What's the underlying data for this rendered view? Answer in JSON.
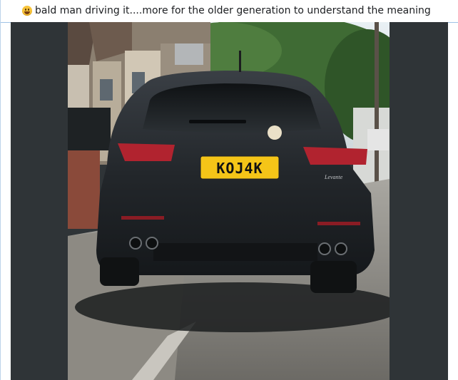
{
  "post": {
    "emoji_icon": "grinning-face-icon",
    "caption": "bald man driving it....more for the older generation to understand the meaning"
  },
  "photo": {
    "plate": "KOJ4K",
    "badge": "Levante",
    "colors": {
      "car": "#2a2d31",
      "plate": "#f5c518",
      "road": "#7c7a75",
      "sky": "#d9e6ee",
      "trees": "#3f6b34"
    }
  }
}
